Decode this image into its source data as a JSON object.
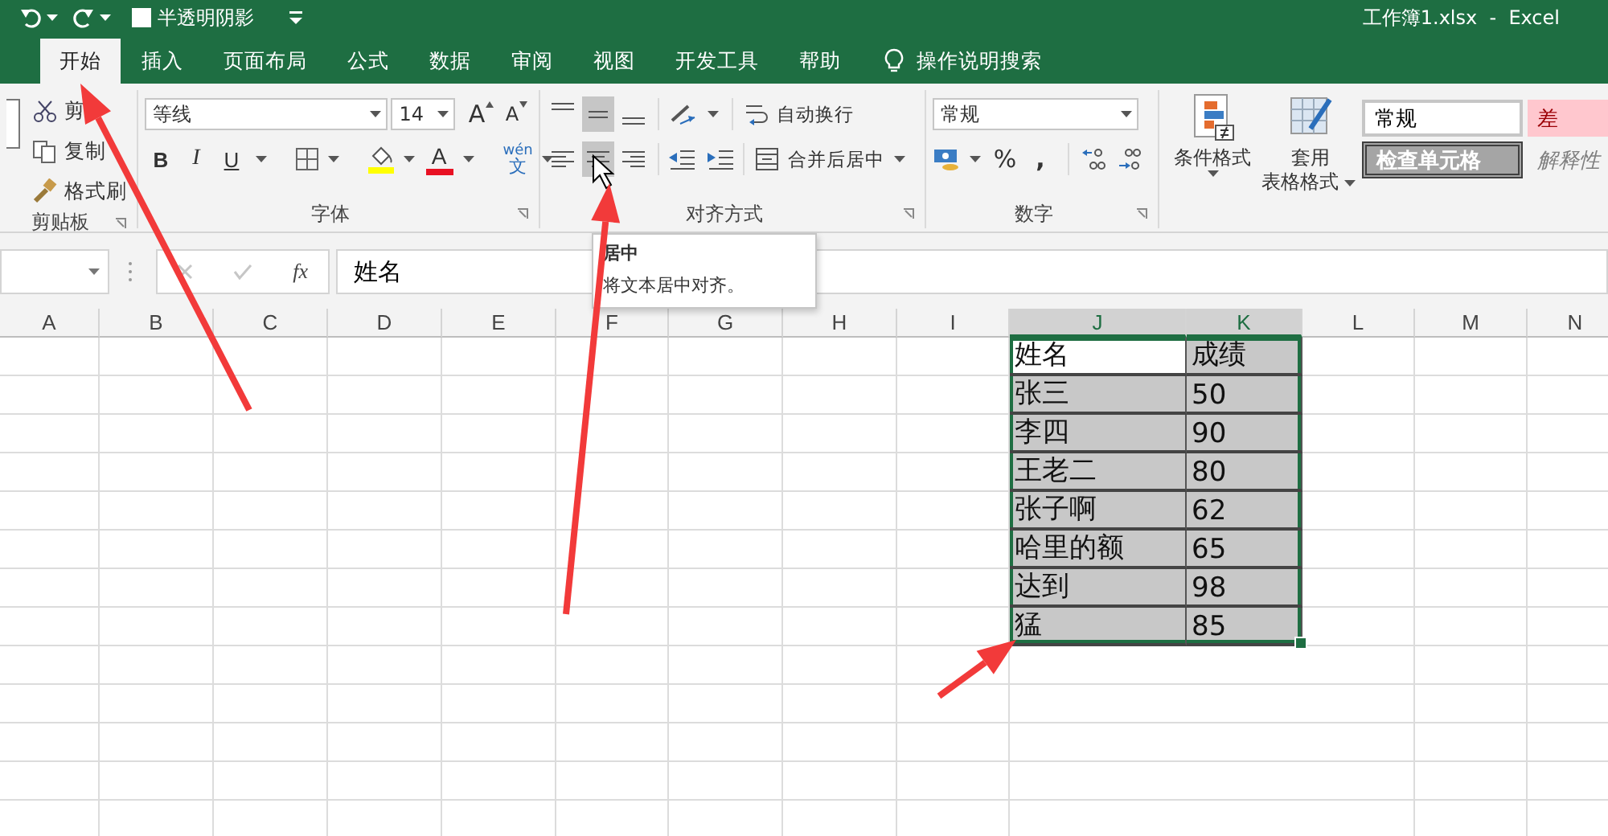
{
  "title_bar": {
    "quick_access_checkbox": {
      "label": "半透明阴影",
      "checked": false
    },
    "title": "工作簿1.xlsx  -  Excel"
  },
  "tabs": [
    {
      "label": "开始",
      "selected": true
    },
    {
      "label": "插入",
      "selected": false
    },
    {
      "label": "页面布局",
      "selected": false
    },
    {
      "label": "公式",
      "selected": false
    },
    {
      "label": "数据",
      "selected": false
    },
    {
      "label": "审阅",
      "selected": false
    },
    {
      "label": "视图",
      "selected": false
    },
    {
      "label": "开发工具",
      "selected": false
    },
    {
      "label": "帮助",
      "selected": false
    }
  ],
  "tell_me": "操作说明搜索",
  "clipboard": {
    "items": [
      {
        "kind": "cut",
        "label": "剪"
      },
      {
        "kind": "copy",
        "label": "复制"
      },
      {
        "kind": "painter",
        "label": "格式刷"
      }
    ],
    "group_label": "剪贴板"
  },
  "font": {
    "name": "等线",
    "size": "14",
    "grow": "A",
    "shrink": "A",
    "bold": "B",
    "italic": "I",
    "underline": "U",
    "font_color": "A",
    "phonetic": [
      "wén",
      "文"
    ],
    "group_label": "字体"
  },
  "alignment": {
    "vertical": [
      {
        "kind": "top",
        "selected": false
      },
      {
        "kind": "middle",
        "selected": true
      },
      {
        "kind": "bottom",
        "selected": false
      }
    ],
    "horizontal": [
      {
        "kind": "left",
        "selected": false
      },
      {
        "kind": "center",
        "selected": true
      },
      {
        "kind": "right",
        "selected": false
      }
    ],
    "wrap": "自动换行",
    "merge": "合并后居中",
    "group_label": "对齐方式"
  },
  "number": {
    "format": "常规",
    "percent": "%",
    "comma": ",",
    "group_label": "数字"
  },
  "styles": {
    "conditional": "条件格式",
    "table_format": [
      "套用",
      "表格格式"
    ],
    "cell_styles": [
      {
        "kind": "normal",
        "label": "常规"
      },
      {
        "kind": "bad",
        "label": "差"
      },
      {
        "kind": "check",
        "label": "检查单元格"
      },
      {
        "kind": "explanatory",
        "label": "解释性"
      }
    ]
  },
  "formula_bar": {
    "function_label": "fx",
    "value": "姓名"
  },
  "tooltip": {
    "title": "居中",
    "description": "将文本居中对齐。"
  },
  "grid": {
    "columns": [
      {
        "label": "A",
        "selected": false
      },
      {
        "label": "B",
        "selected": false
      },
      {
        "label": "C",
        "selected": false
      },
      {
        "label": "D",
        "selected": false
      },
      {
        "label": "E",
        "selected": false
      },
      {
        "label": "F",
        "selected": false
      },
      {
        "label": "G",
        "selected": false
      },
      {
        "label": "H",
        "selected": false
      },
      {
        "label": "I",
        "selected": false
      },
      {
        "label": "J",
        "selected": true
      },
      {
        "label": "K",
        "selected": true
      },
      {
        "label": "L",
        "selected": false
      },
      {
        "label": "M",
        "selected": false
      },
      {
        "label": "N",
        "selected": false
      }
    ],
    "rows": [
      [
        "姓名",
        "成绩"
      ],
      [
        "张三",
        "50"
      ],
      [
        "李四",
        "90"
      ],
      [
        "王老二",
        "80"
      ],
      [
        "张子啊",
        "62"
      ],
      [
        "哈里的额",
        "65"
      ],
      [
        "达到",
        "98"
      ],
      [
        "猛",
        "85"
      ]
    ]
  }
}
